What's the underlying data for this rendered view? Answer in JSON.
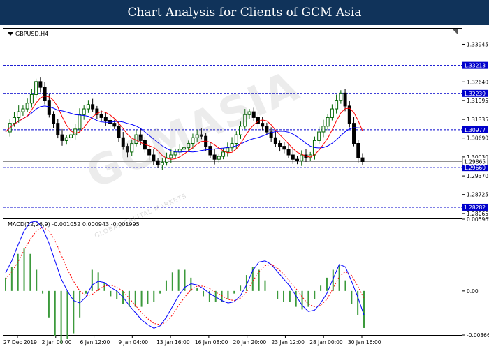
{
  "banner": {
    "title": "Chart Analysis for Clients of GCM Asia"
  },
  "main": {
    "symbol": "GBPUSD,H4"
  },
  "macd": {
    "label": "MACD(12,26,9) -0.001052 0.000943 -0.001995"
  },
  "watermark": {
    "text": "GCMASIA",
    "sub": "GLOBAL CAPITAL MARKETS"
  },
  "colors": {
    "bull": "#006400",
    "bear": "#000000",
    "ma_fast": "#ff0000",
    "ma_slow": "#0000ff",
    "level_line": "#0000cc",
    "highlight": "#0000cc",
    "hist": "#3c9a3c",
    "signal": "#ff0000",
    "macd_line": "#0000ff"
  },
  "chart_data": [
    {
      "type": "candlestick",
      "title": "GBPUSD,H4",
      "ylim": [
        1.2799,
        1.3449
      ],
      "y_ticks": [
        "1.33945",
        "1.32640",
        "1.31995",
        "1.31335",
        "1.30690",
        "1.30030",
        "1.29370",
        "1.28725",
        "1.28065"
      ],
      "levels": [
        {
          "value": 1.33213,
          "label": "1.33213"
        },
        {
          "value": 1.32239,
          "label": "1.32239"
        },
        {
          "value": 1.30977,
          "label": "1.30977"
        },
        {
          "value": 1.2966,
          "label": "1.29660"
        },
        {
          "value": 1.28282,
          "label": "1.28282"
        }
      ],
      "current_price": {
        "value": 1.29865,
        "label": "1.29865"
      },
      "x_ticks": [
        "27 Dec 2019",
        "2 Jan 00:00",
        "6 Jan 12:00",
        "9 Jan 04:00",
        "13 Jan 16:00",
        "16 Jan 08:00",
        "20 Jan 20:00",
        "23 Jan 12:00",
        "28 Jan 00:00",
        "30 Jan 16:00"
      ],
      "close_path": [
        1.309,
        1.312,
        1.314,
        1.316,
        1.317,
        1.319,
        1.322,
        1.3265,
        1.3245,
        1.32,
        1.315,
        1.312,
        1.308,
        1.306,
        1.307,
        1.308,
        1.31,
        1.315,
        1.317,
        1.3185,
        1.317,
        1.315,
        1.314,
        1.313,
        1.312,
        1.311,
        1.307,
        1.304,
        1.302,
        1.305,
        1.308,
        1.306,
        1.303,
        1.301,
        1.299,
        1.2975,
        1.2985,
        1.3,
        1.301,
        1.302,
        1.303,
        1.3035,
        1.305,
        1.307,
        1.308,
        1.3075,
        1.304,
        1.301,
        1.2995,
        1.3005,
        1.302,
        1.3035,
        1.305,
        1.308,
        1.311,
        1.315,
        1.316,
        1.314,
        1.312,
        1.311,
        1.309,
        1.307,
        1.305,
        1.304,
        1.303,
        1.301,
        1.2995,
        1.299,
        1.301,
        1.3,
        1.301,
        1.306,
        1.309,
        1.311,
        1.314,
        1.317,
        1.32,
        1.3225,
        1.318,
        1.312,
        1.305,
        1.3,
        1.2987
      ]
    },
    {
      "type": "macd",
      "title": "MACD(12,26,9)",
      "ylim": [
        -0.003663,
        0.005965
      ],
      "y_ticks": [
        "0.005965",
        "0.00",
        "-0.003663"
      ],
      "series": [
        {
          "name": "MACD",
          "values": [
            0.0015,
            0.0025,
            0.0038,
            0.005,
            0.0057,
            0.0058,
            0.0052,
            0.004,
            0.0025,
            0.001,
            0.0,
            -0.0008,
            -0.001,
            -0.0005,
            0.0005,
            0.0008,
            0.0007,
            0.0003,
            0.0,
            -0.0005,
            -0.0012,
            -0.0018,
            -0.0024,
            -0.0028,
            -0.0031,
            -0.0029,
            -0.0022,
            -0.0013,
            -0.0004,
            0.0003,
            0.0006,
            0.0005,
            0.0002,
            -0.0002,
            -0.0005,
            -0.0008,
            -0.001,
            -0.0009,
            -0.0004,
            0.0005,
            0.0017,
            0.0024,
            0.0025,
            0.0022,
            0.0016,
            0.001,
            0.0004,
            -0.0004,
            -0.0012,
            -0.0017,
            -0.0016,
            -0.001,
            -0.0002,
            0.001,
            0.0022,
            0.002,
            0.0008,
            -0.0005,
            -0.002
          ]
        },
        {
          "name": "Signal",
          "values": [
            0.001,
            0.0016,
            0.0024,
            0.0034,
            0.0043,
            0.005,
            0.0053,
            0.005,
            0.0042,
            0.003,
            0.0018,
            0.0008,
            0.0,
            -0.0004,
            -0.0003,
            0.0001,
            0.0004,
            0.0005,
            0.0003,
            0.0,
            -0.0006,
            -0.0012,
            -0.0018,
            -0.0023,
            -0.0027,
            -0.0028,
            -0.0026,
            -0.002,
            -0.0012,
            -0.0005,
            0.0001,
            0.0004,
            0.0004,
            0.0002,
            -0.0001,
            -0.0004,
            -0.0007,
            -0.0008,
            -0.0006,
            -0.0001,
            0.0008,
            0.0016,
            0.0021,
            0.0022,
            0.0019,
            0.0014,
            0.0008,
            0.0002,
            -0.0005,
            -0.0011,
            -0.0013,
            -0.0012,
            -0.0007,
            0.0002,
            0.0012,
            0.0016,
            0.0013,
            0.0004,
            -0.0006
          ]
        }
      ]
    }
  ]
}
